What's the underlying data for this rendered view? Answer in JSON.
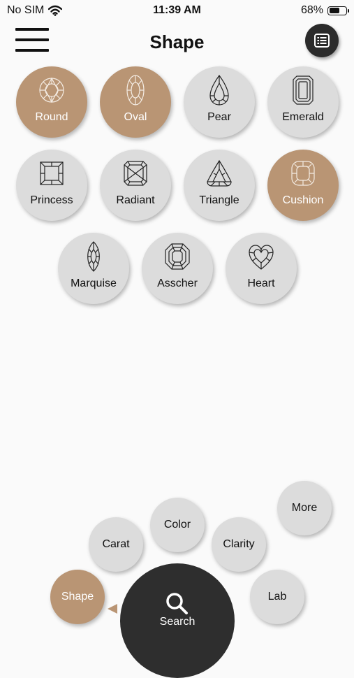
{
  "status": {
    "carrier": "No SIM",
    "time": "11:39 AM",
    "battery": "68%",
    "battery_level": 0.68
  },
  "header": {
    "title": "Shape"
  },
  "shapes": [
    {
      "label": "Round",
      "selected": true,
      "icon": "round-diamond-icon"
    },
    {
      "label": "Oval",
      "selected": true,
      "icon": "oval-diamond-icon"
    },
    {
      "label": "Pear",
      "selected": false,
      "icon": "pear-diamond-icon"
    },
    {
      "label": "Emerald",
      "selected": false,
      "icon": "emerald-diamond-icon"
    },
    {
      "label": "Princess",
      "selected": false,
      "icon": "princess-diamond-icon"
    },
    {
      "label": "Radiant",
      "selected": false,
      "icon": "radiant-diamond-icon"
    },
    {
      "label": "Triangle",
      "selected": false,
      "icon": "triangle-diamond-icon"
    },
    {
      "label": "Cushion",
      "selected": true,
      "icon": "cushion-diamond-icon"
    },
    {
      "label": "Marquise",
      "selected": false,
      "icon": "marquise-diamond-icon"
    },
    {
      "label": "Asscher",
      "selected": false,
      "icon": "asscher-diamond-icon"
    },
    {
      "label": "Heart",
      "selected": false,
      "icon": "heart-diamond-icon"
    }
  ],
  "nav": {
    "shape": "Shape",
    "carat": "Carat",
    "color": "Color",
    "clarity": "Clarity",
    "more": "More",
    "lab": "Lab",
    "search": "Search"
  },
  "colors": {
    "selected": "#b99574",
    "unselected": "#dcdcdc",
    "dark": "#2e2e2e"
  }
}
